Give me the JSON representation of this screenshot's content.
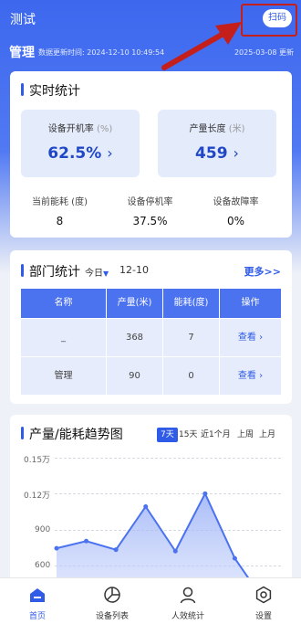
{
  "header": {
    "app_title": "测试",
    "scan_label": "扫码",
    "section_title": "管理",
    "update_time": "数据更新时间: 2024-12-10 10:49:54",
    "right_date": "2025-03-08 更新"
  },
  "realtime": {
    "title": "实时统计",
    "box1": {
      "label": "设备开机率",
      "unit": "(%)",
      "value": "62.5%"
    },
    "box2": {
      "label": "产量长度",
      "unit": "(米)",
      "value": "459"
    },
    "mini": [
      {
        "label": "当前能耗 (度)",
        "value": "8"
      },
      {
        "label": "设备停机率",
        "value": "37.5%"
      },
      {
        "label": "设备故障率",
        "value": "0%"
      }
    ]
  },
  "dept": {
    "title": "部门统计",
    "period": "今日",
    "date": "12-10",
    "more": "更多>>",
    "headers": [
      "名称",
      "产量(米)",
      "能耗(度)",
      "操作"
    ],
    "rows": [
      {
        "name": "_",
        "output": "368",
        "energy": "7",
        "action": "查看"
      },
      {
        "name": "管理",
        "output": "90",
        "energy": "0",
        "action": "查看"
      }
    ]
  },
  "trend": {
    "title": "产量/能耗趋势图",
    "ranges": [
      "7天",
      "15天",
      "近1个月",
      "上周",
      "上月"
    ],
    "active_range": "7天"
  },
  "chart_data": {
    "type": "area",
    "title": "产量/能耗趋势图",
    "yticks": [
      "0.15万",
      "0.12万",
      "900",
      "600"
    ],
    "ylim": [
      500,
      1500
    ],
    "values": [
      870,
      920,
      860,
      1160,
      850,
      1250,
      800,
      500
    ],
    "color": "#4b72ef",
    "grid": true
  },
  "tabbar": {
    "items": [
      {
        "label": "首页",
        "icon": "home-icon",
        "active": true
      },
      {
        "label": "设备列表",
        "icon": "pie-chart-icon",
        "active": false
      },
      {
        "label": "人效统计",
        "icon": "person-icon",
        "active": false
      },
      {
        "label": "设置",
        "icon": "gear-icon",
        "active": false
      }
    ]
  },
  "colors": {
    "primary": "#2f5be6",
    "annotation": "#c41f1a"
  }
}
